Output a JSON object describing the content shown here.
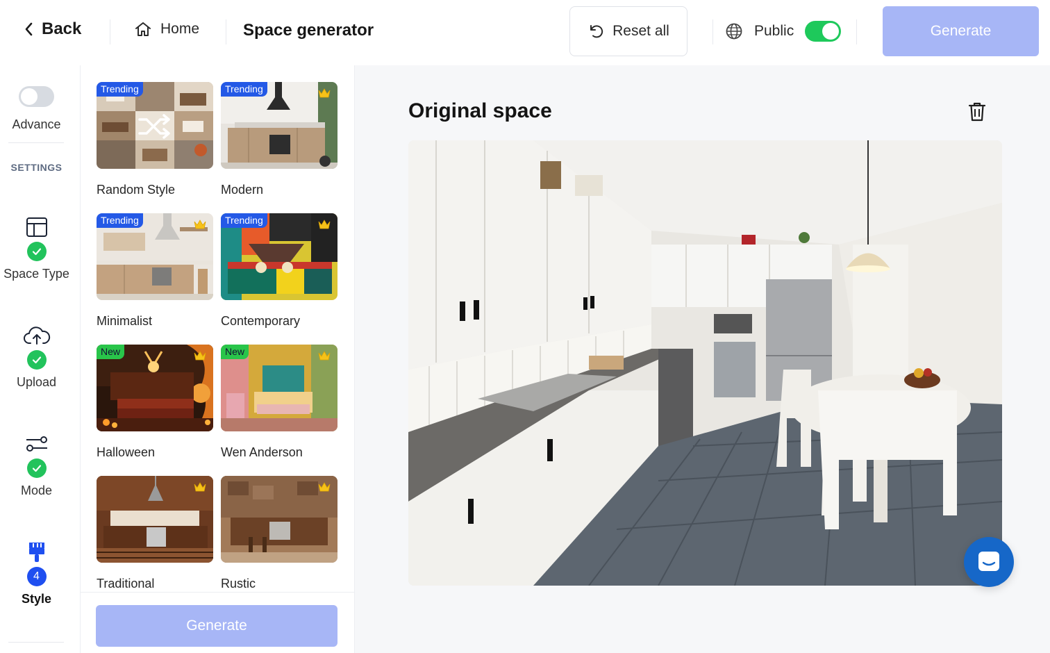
{
  "topbar": {
    "back_label": "Back",
    "home_label": "Home",
    "page_title": "Space generator",
    "reset_label": "Reset all",
    "public_label": "Public",
    "public_enabled": true,
    "generate_label": "Generate"
  },
  "rail": {
    "advance_label": "Advance",
    "advance_enabled": false,
    "settings_label": "SETTINGS",
    "steps": [
      {
        "label": "Space Type",
        "icon": "layout-icon",
        "status": "done"
      },
      {
        "label": "Upload",
        "icon": "cloud-upload-icon",
        "status": "done"
      },
      {
        "label": "Mode",
        "icon": "sliders-icon",
        "status": "done"
      },
      {
        "label": "Style",
        "icon": "paintbrush-icon",
        "status": "current",
        "number": "4"
      }
    ]
  },
  "styles": [
    {
      "name": "Random Style",
      "badge": "Trending",
      "premium": false
    },
    {
      "name": "Modern",
      "badge": "Trending",
      "premium": true
    },
    {
      "name": "Minimalist",
      "badge": "Trending",
      "premium": true
    },
    {
      "name": "Contemporary",
      "badge": "Trending",
      "premium": true
    },
    {
      "name": "Halloween",
      "badge": "New",
      "premium": true
    },
    {
      "name": "Wen Anderson",
      "badge": "New",
      "premium": true
    },
    {
      "name": "Traditional",
      "badge": "",
      "premium": true
    },
    {
      "name": "Rustic",
      "badge": "",
      "premium": true
    }
  ],
  "panel": {
    "generate_label": "Generate"
  },
  "main": {
    "title": "Original space"
  },
  "colors": {
    "accent_blue": "#1f4ff0",
    "disabled_button": "#a7b6f6",
    "toggle_on": "#1ec95b",
    "success": "#22c35c",
    "badge_trending": "#2459e6",
    "badge_new": "#29c54a",
    "chat_button": "#1667c8"
  }
}
